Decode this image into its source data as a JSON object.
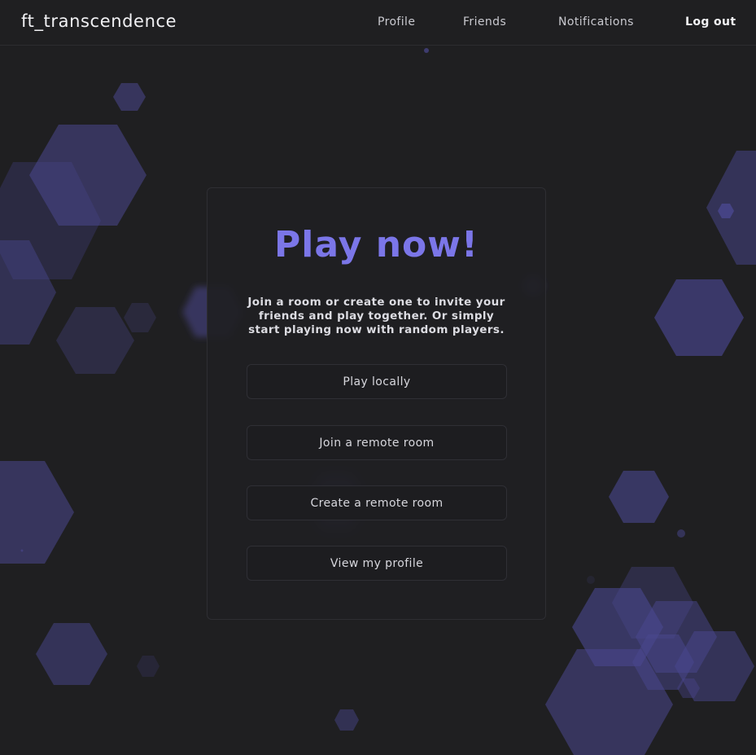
{
  "navbar": {
    "brand": "ft_transcendence",
    "links": {
      "profile": "Profile",
      "friends": "Friends",
      "notifications": "Notifications",
      "logout": "Log out"
    }
  },
  "card": {
    "title": "Play now!",
    "description": "Join a room or create one to invite your friends and play together. Or simply start playing now with random players.",
    "buttons": {
      "play_locally": "Play locally",
      "join_remote": "Join a remote room",
      "create_remote": "Create a remote room",
      "view_profile": "View my profile"
    }
  },
  "colors": {
    "background": "#1f1f21",
    "accent": "#7b76e8",
    "hexagon": "#4a4790"
  }
}
